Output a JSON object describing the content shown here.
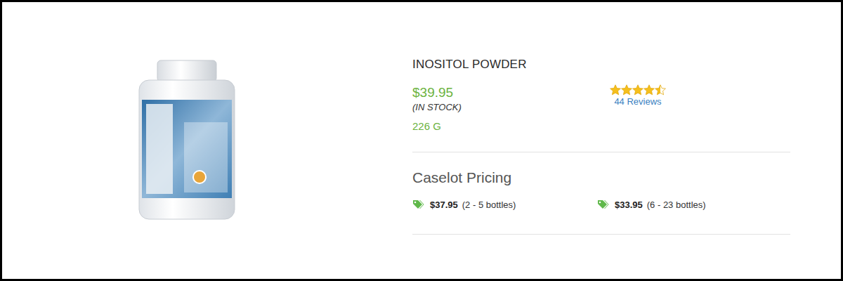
{
  "product": {
    "title": "INOSITOL POWDER",
    "price": "$39.95",
    "availability": "(IN STOCK)",
    "size": "226 G",
    "rating": {
      "stars": 4.5,
      "reviews": "44 Reviews"
    }
  },
  "caselot": {
    "heading": "Caselot Pricing",
    "tiers": [
      {
        "price": "$37.95",
        "quantity": "(2 - 5 bottles)"
      },
      {
        "price": "$33.95",
        "quantity": "(6 - 23 bottles)"
      }
    ]
  }
}
